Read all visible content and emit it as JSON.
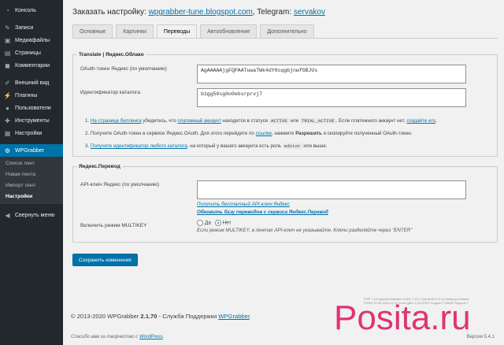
{
  "sidebar": {
    "items": [
      {
        "label": "Консоль",
        "icon": "dashboard-icon"
      },
      {
        "label": "Записи",
        "icon": "pin-icon"
      },
      {
        "label": "Медиафайлы",
        "icon": "media-icon"
      },
      {
        "label": "Страницы",
        "icon": "page-icon"
      },
      {
        "label": "Комментарии",
        "icon": "comment-icon"
      },
      {
        "label": "Внешний вид",
        "icon": "brush-icon"
      },
      {
        "label": "Плагины",
        "icon": "plugin-icon"
      },
      {
        "label": "Пользователи",
        "icon": "user-icon"
      },
      {
        "label": "Инструменты",
        "icon": "wrench-icon"
      },
      {
        "label": "Настройки",
        "icon": "settings-icon"
      },
      {
        "label": "WPGrabber",
        "icon": "gear-icon"
      }
    ],
    "submenu": [
      "Список лент",
      "Новая лента",
      "Импорт лент",
      "Настройки"
    ],
    "collapse_label": "Свернуть меню"
  },
  "header": {
    "prefix": "Заказать настройку:",
    "site": "wpgrabber-tune.blogspot.com",
    "telegram_label": ", Telegram:",
    "telegram_user": "servakov"
  },
  "tabs": [
    "Основные",
    "Картинки",
    "Переводы",
    "Автообновление",
    "Дополнительно"
  ],
  "yandex_cloud": {
    "legend": "Translate | Яндекс.Облако",
    "oauth_label": "OAuth-токен Яндекс (по умолчанию)",
    "oauth_value": "AgAAAAAjgFQPAATuwaTWk4dY0cqgbjnwfGBJUs",
    "catalog_label": "Идентификатор каталога",
    "catalog_value": "b1gg50sg0o0ebsrprvj7",
    "step1_a": "1.",
    "step1_link1": "На странице биллинга",
    "step1_b": "убедитесь, что",
    "step1_link2": "платежный аккаунт",
    "step1_c": "находится в статусе",
    "step1_code1": "ACTIVE",
    "step1_d": "или",
    "step1_code2": "TRIAL_ACTIVE",
    "step1_e": ". Если платежного аккаунт нет,",
    "step1_link3": "создайте его",
    "step1_f": ".",
    "step2_a": "2. Получите OAuth-токен в сервисе Яндекс.OAuth. Для этого перейдите по",
    "step2_link": "ссылке",
    "step2_b": ", нажмите",
    "step2_bold": "Разрешить",
    "step2_c": "и скопируйте полученный OAuth-токен.",
    "step3_a": "3.",
    "step3_link": "Получите идентификатор любого каталога",
    "step3_b": ", на который у вашего аккаунта есть роль",
    "step3_code": "editor",
    "step3_c": "или выше."
  },
  "yandex_translate": {
    "legend": "Яндекс.Перевод",
    "api_label": "API-ключ Яндекс (по умолчанию)",
    "api_value": "",
    "link_free": "Получить бесплатный API-ключ Яндекс",
    "link_update": "Обновить базу переводов с сервиса Яндекс.Перевод",
    "multikey_label": "Включить режим MULTIKEY",
    "radio_yes": "Да",
    "radio_no": "Нет",
    "multikey_hint": "Если режим MULTIKEY, в лентах API-ключ не указывайте. Ключи разделяйте через \"ENTER\""
  },
  "save_button": "Сохранить изменения",
  "sysinfo": {
    "line1": "PHP 7.4.0  apache2handler  CURL 7.52.1  OpenSSL/1.0.2j  mbstring enabled",
    "line2": "PCRE 10.34 2019-11-21  iconv glibc 2.24  JPEG Support 1  WebP Support 1"
  },
  "copyright": {
    "text": "© 2013-2020 WPGrabber",
    "version": "2.1.70",
    "support": "- Служба Поддержки",
    "link": "WPGrabber",
    "dot": "."
  },
  "footer": {
    "thanks": "Спасибо вам за творчество с",
    "wp_link": "WordPress",
    "dot": ".",
    "version": "Версия 5.4.1"
  },
  "watermark_text": "Posita.ru",
  "colors": {
    "accent": "#0073aa",
    "sidebar_bg": "#23282d",
    "watermark": "#e0115f"
  }
}
